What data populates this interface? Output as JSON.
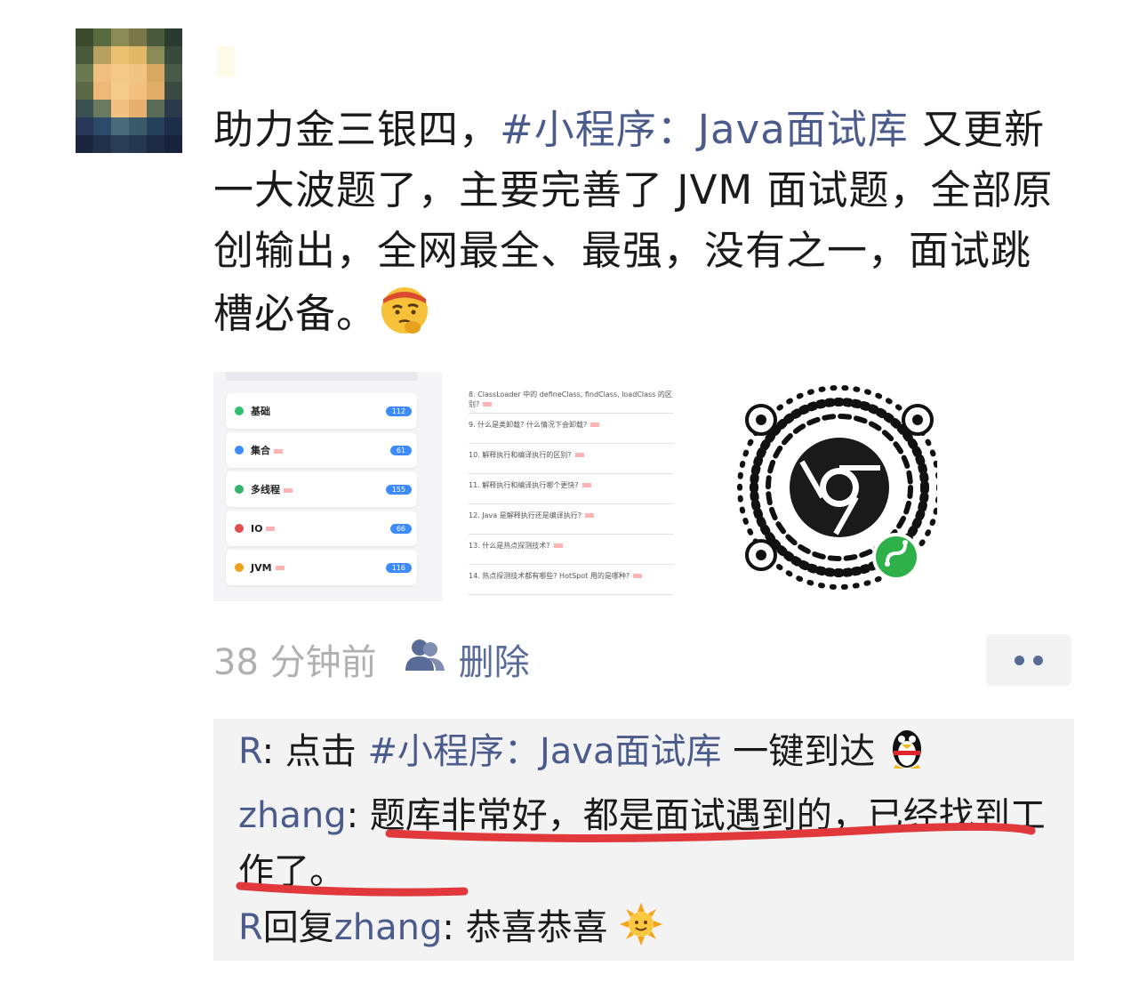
{
  "post": {
    "text_plain_1": "助力金三银四，",
    "tag": "#小程序：Java面试库",
    "text_plain_2": " 又更新一大波题了，主要完善了 JVM 面试题，全部原创输出，全网最全、最强，没有之一，面试跳槽必备。",
    "emoji": "thinking-face-with-headband"
  },
  "thumbnails": {
    "categories": [
      {
        "label": "基础",
        "count": "112",
        "is_new": false,
        "color": "#2fbf71"
      },
      {
        "label": "集合",
        "count": "61",
        "is_new": true,
        "color": "#3d8bff"
      },
      {
        "label": "多线程",
        "count": "155",
        "is_new": true,
        "color": "#33b36b"
      },
      {
        "label": "IO",
        "count": "66",
        "is_new": true,
        "color": "#e05050"
      },
      {
        "label": "JVM",
        "count": "116",
        "is_new": true,
        "color": "#f0a020"
      }
    ],
    "questions": [
      "8. ClassLoader 中的 defineClass, findClass, loadClass 的区别?",
      "9. 什么是类卸载? 什么情况下会卸载?",
      "10. 解释执行和编译执行的区别?",
      "11. 解释执行和编译执行哪个更快?",
      "12. Java 是解释执行还是编译执行?",
      "13. 什么是热点探测技术?",
      "14. 热点探测技术都有哪些? HotSpot 用的是哪种?"
    ],
    "qr_icons": [
      "chrome-icon",
      "mini-program-icon"
    ]
  },
  "meta": {
    "time": "38 分钟前",
    "delete_label": "删除"
  },
  "comments": [
    {
      "user": "R",
      "text": "点击 ",
      "tag": "#小程序：Java面试库",
      "suffix": " 一键到达",
      "emoji": "qq-penguin"
    },
    {
      "user": "zhang",
      "text": "题库非常好，都是面试遇到的，已经找到工作了。"
    },
    {
      "user": "R",
      "reply_word": "回复",
      "reply_to": "zhang",
      "text": "恭喜恭喜",
      "emoji": "sun-face"
    }
  ],
  "colors": {
    "link": "#4b5b8c",
    "underline": "#e0383b",
    "comment_bg": "#f3f3f3"
  }
}
